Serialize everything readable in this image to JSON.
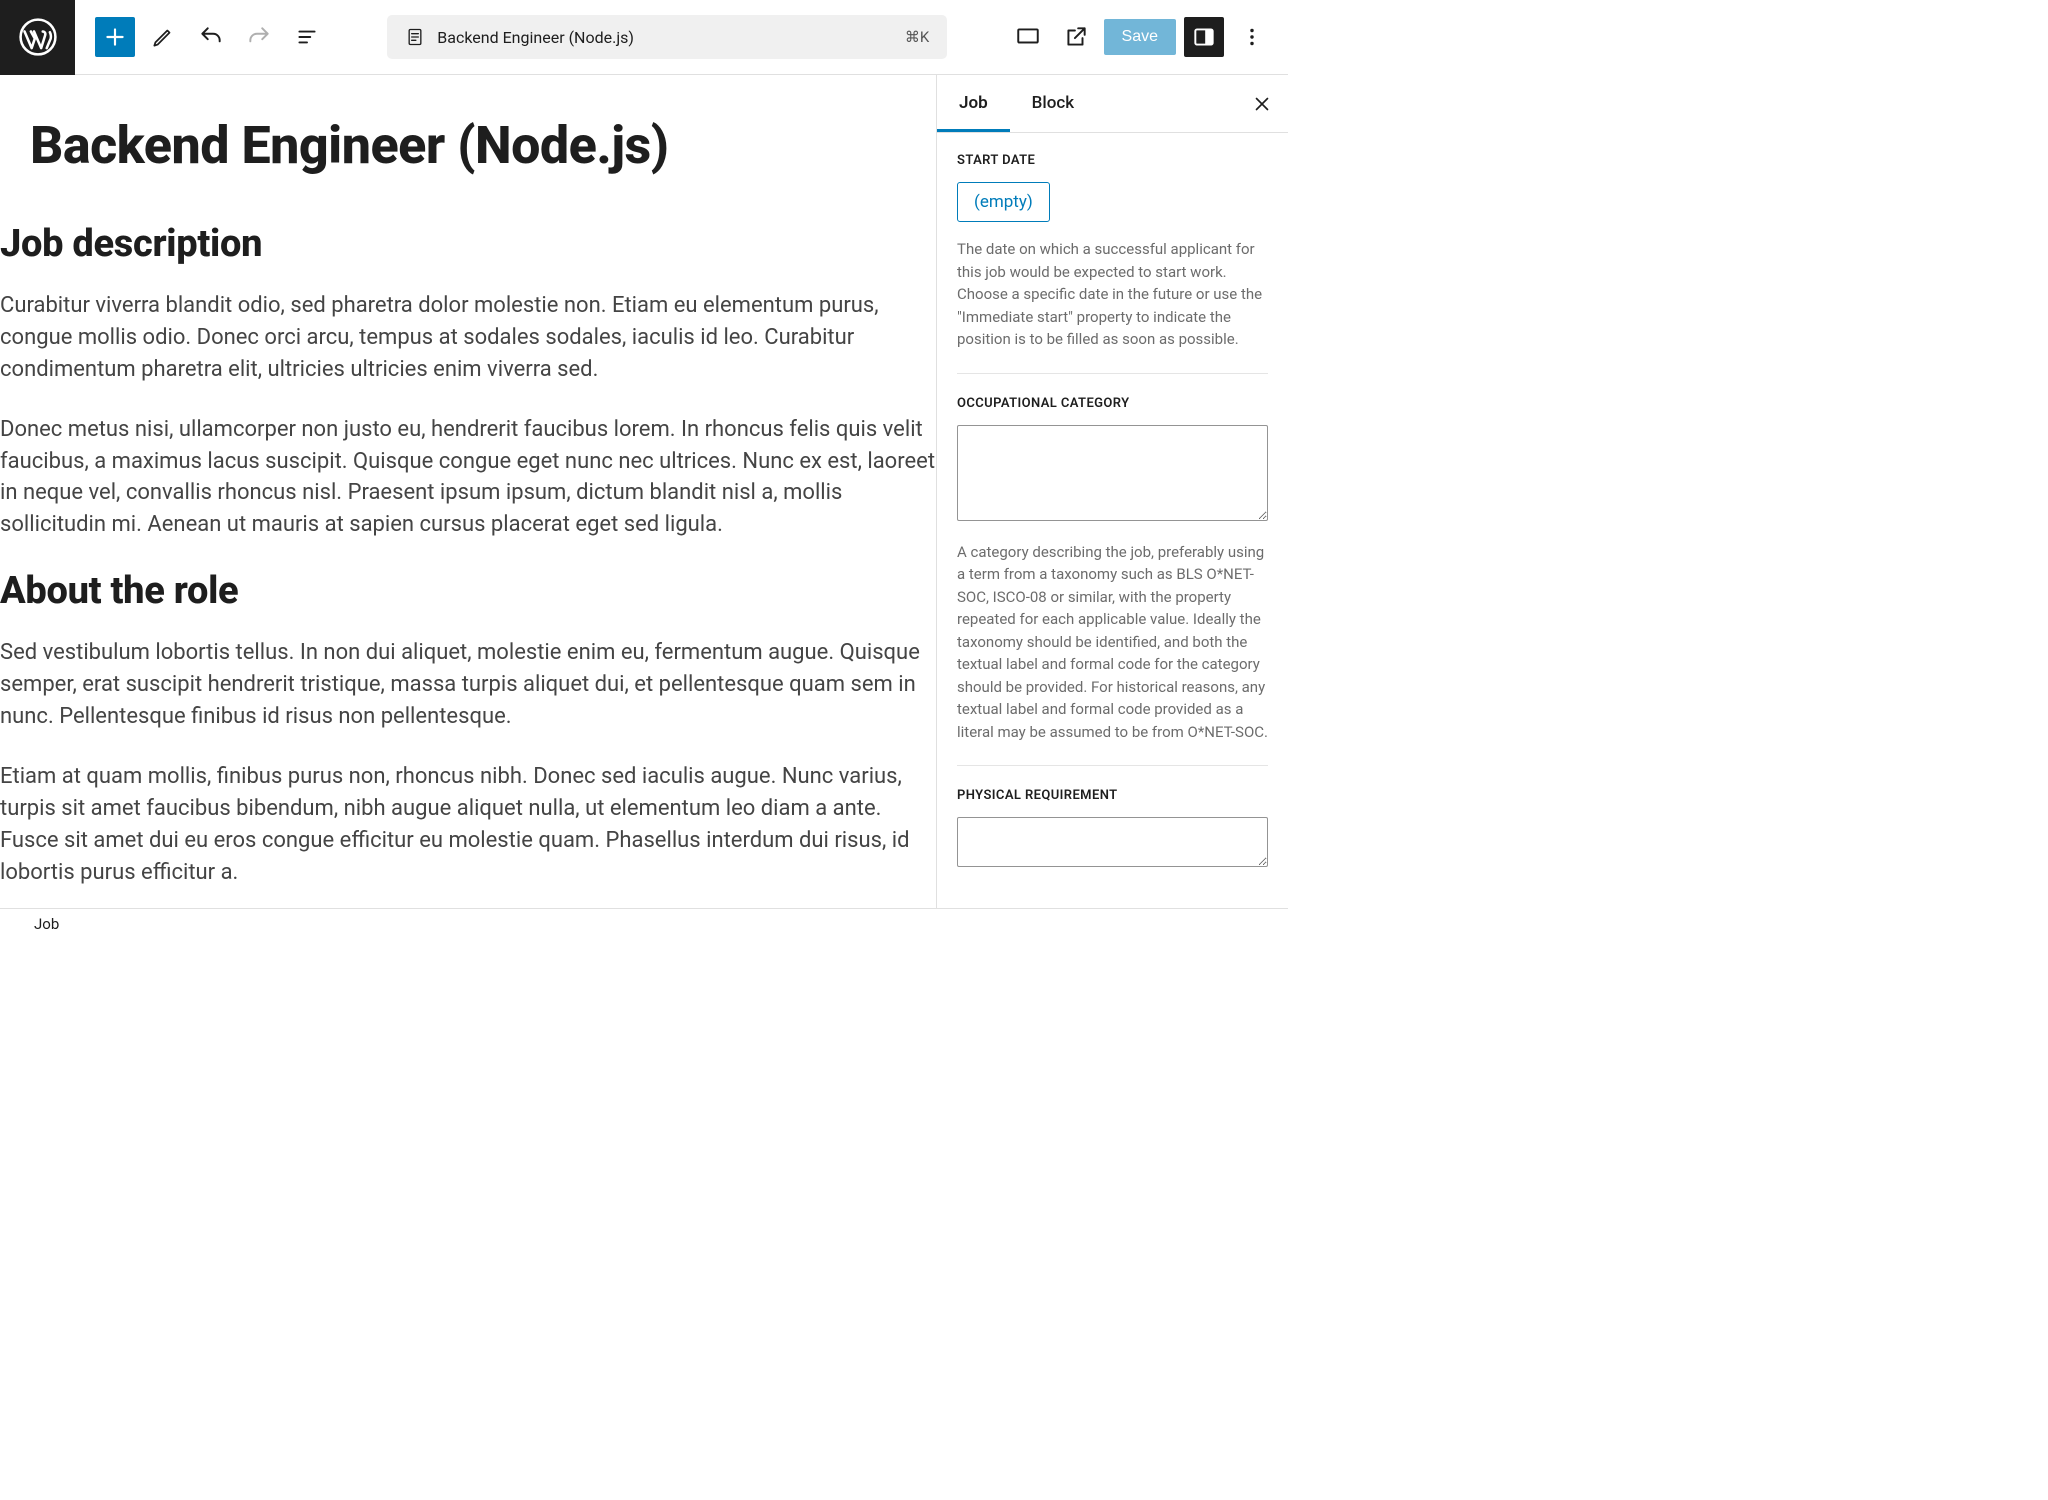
{
  "toolbar": {
    "doc_title": "Backend Engineer (Node.js)",
    "shortcut": "⌘K",
    "save_label": "Save"
  },
  "editor": {
    "title": "Backend Engineer (Node.js)",
    "sections": {
      "h2_1": "Job description",
      "p1": "Curabitur viverra blandit odio, sed pharetra dolor molestie non. Etiam eu elementum purus, congue mollis odio. Donec orci arcu, tempus at sodales sodales, iaculis id leo. Curabitur condimentum pharetra elit, ultricies ultricies enim viverra sed.",
      "p2": "Donec metus nisi, ullamcorper non justo eu, hendrerit faucibus lorem. In rhoncus felis quis velit faucibus, a maximus lacus suscipit. Quisque congue eget nunc nec ultrices. Nunc ex est, laoreet in neque vel, convallis rhoncus nisl. Praesent ipsum ipsum, dictum blandit nisl a, mollis sollicitudin mi. Aenean ut mauris at sapien cursus placerat eget sed ligula.",
      "h2_2": "About the role",
      "p3": "Sed vestibulum lobortis tellus. In non dui aliquet, molestie enim eu, fermentum augue. Quisque semper, erat suscipit hendrerit tristique, massa turpis aliquet dui, et pellentesque quam sem in nunc. Pellentesque finibus id risus non pellentesque.",
      "p4": "Etiam at quam mollis, finibus purus non, rhoncus nibh. Donec sed iaculis augue. Nunc varius, turpis sit amet faucibus bibendum, nibh augue aliquet nulla, ut elementum leo diam a ante. Fusce sit amet dui eu eros congue efficitur eu molestie quam. Phasellus interdum dui risus, id lobortis purus efficitur a."
    }
  },
  "sidebar": {
    "tabs": {
      "job": "Job",
      "block": "Block"
    },
    "start_date": {
      "label": "START DATE",
      "empty": "(empty)",
      "desc": "The date on which a successful applicant for this job would be expected to start work. Choose a specific date in the future or use the \"Immediate start\" property to indicate the position is to be filled as soon as possible."
    },
    "occ_cat": {
      "label": "OCCUPATIONAL CATEGORY",
      "value": "",
      "desc": "A category describing the job, preferably using a term from a taxonomy such as BLS O*NET-SOC, ISCO-08 or similar, with the property repeated for each applicable value. Ideally the taxonomy should be identified, and both the textual label and formal code for the category should be provided. For historical reasons, any textual label and formal code provided as a literal may be assumed to be from O*NET-SOC."
    },
    "phys_req": {
      "label": "PHYSICAL REQUIREMENT",
      "value": ""
    }
  },
  "footer": {
    "breadcrumb": "Job"
  }
}
